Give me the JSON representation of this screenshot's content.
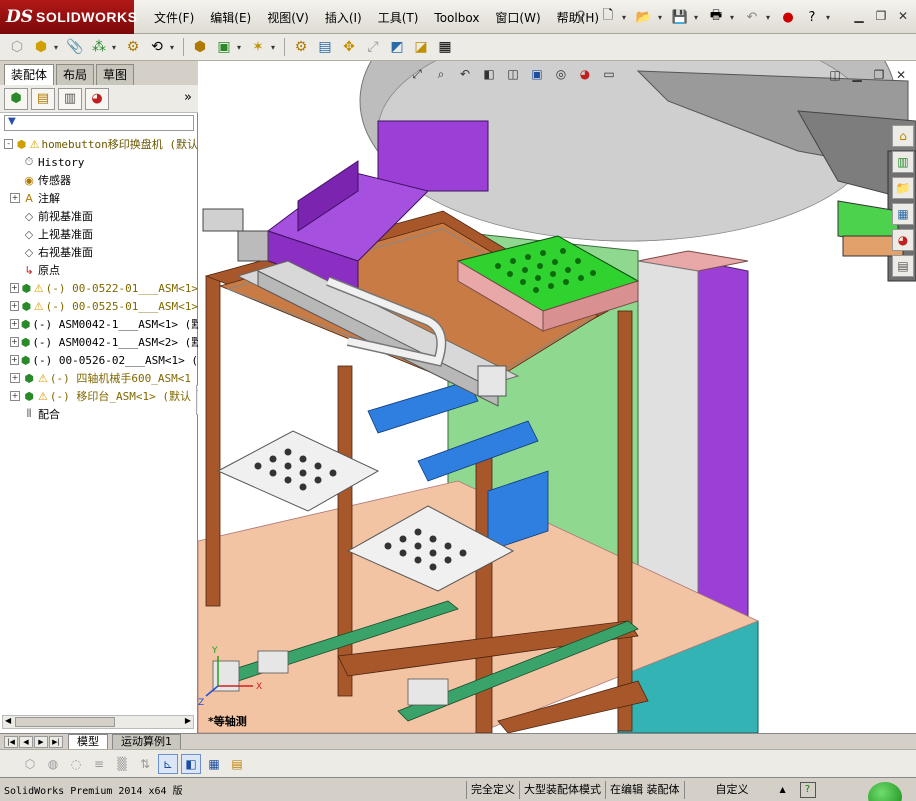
{
  "app": {
    "logo_ds": "DS",
    "logo_text": "SOLIDWORKS"
  },
  "menu": [
    "文件(F)",
    "编辑(E)",
    "视图(V)",
    "插入(I)",
    "工具(T)",
    "Toolbox",
    "窗口(W)",
    "帮助(H)"
  ],
  "pane": {
    "tabs": [
      "装配体",
      "布局",
      "草图"
    ],
    "more": "»",
    "filter_icon": "▼",
    "tree": [
      {
        "label": "homebutton移印换盘机  (默认",
        "type": "root",
        "warn": true,
        "expand": "-"
      },
      {
        "label": "History",
        "type": "history",
        "warn": false,
        "expand": ""
      },
      {
        "label": "传感器",
        "type": "sensor",
        "warn": false,
        "expand": ""
      },
      {
        "label": "注解",
        "type": "annotation",
        "warn": false,
        "expand": "+"
      },
      {
        "label": "前视基准面",
        "type": "plane",
        "warn": false,
        "expand": ""
      },
      {
        "label": "上视基准面",
        "type": "plane",
        "warn": false,
        "expand": ""
      },
      {
        "label": "右视基准面",
        "type": "plane",
        "warn": false,
        "expand": ""
      },
      {
        "label": "原点",
        "type": "origin",
        "warn": false,
        "expand": ""
      },
      {
        "label": "(-) 00-0522-01___ASM<1>",
        "type": "asm",
        "warn": true,
        "expand": "+"
      },
      {
        "label": "(-) 00-0525-01___ASM<1>",
        "type": "asm",
        "warn": true,
        "expand": "+"
      },
      {
        "label": "(-) ASM0042-1___ASM<1> (默",
        "type": "asm",
        "warn": false,
        "expand": "+"
      },
      {
        "label": "(-) ASM0042-1___ASM<2> (默",
        "type": "asm",
        "warn": false,
        "expand": "+"
      },
      {
        "label": "(-) 00-0526-02___ASM<1> (",
        "type": "asm",
        "warn": false,
        "expand": "+"
      },
      {
        "label": "(-) 四轴机械手600_ASM<1",
        "type": "asm",
        "warn": true,
        "expand": "+"
      },
      {
        "label": "(-) 移印台_ASM<1> (默认",
        "type": "asm",
        "warn": true,
        "expand": "+"
      },
      {
        "label": "配合",
        "type": "mates",
        "warn": false,
        "expand": ""
      }
    ]
  },
  "viewport": {
    "caption": "*等轴测",
    "triad": {
      "x": "X",
      "y": "Y",
      "z": "Z"
    }
  },
  "bottom_tabs": [
    "模型",
    "运动算例1"
  ],
  "status": {
    "product": "SolidWorks Premium 2014 x64 版",
    "cells": [
      "完全定义",
      "大型装配体模式",
      "在编辑 装配体"
    ],
    "custom": "自定义",
    "help": "?"
  },
  "colors": {
    "purple": "#9b3fd6",
    "green": "#2fd22f",
    "wood": "#a8572a",
    "blue": "#2e7fe0",
    "pink": "#e8a8a8",
    "menu_bg": "#dedbd2"
  }
}
